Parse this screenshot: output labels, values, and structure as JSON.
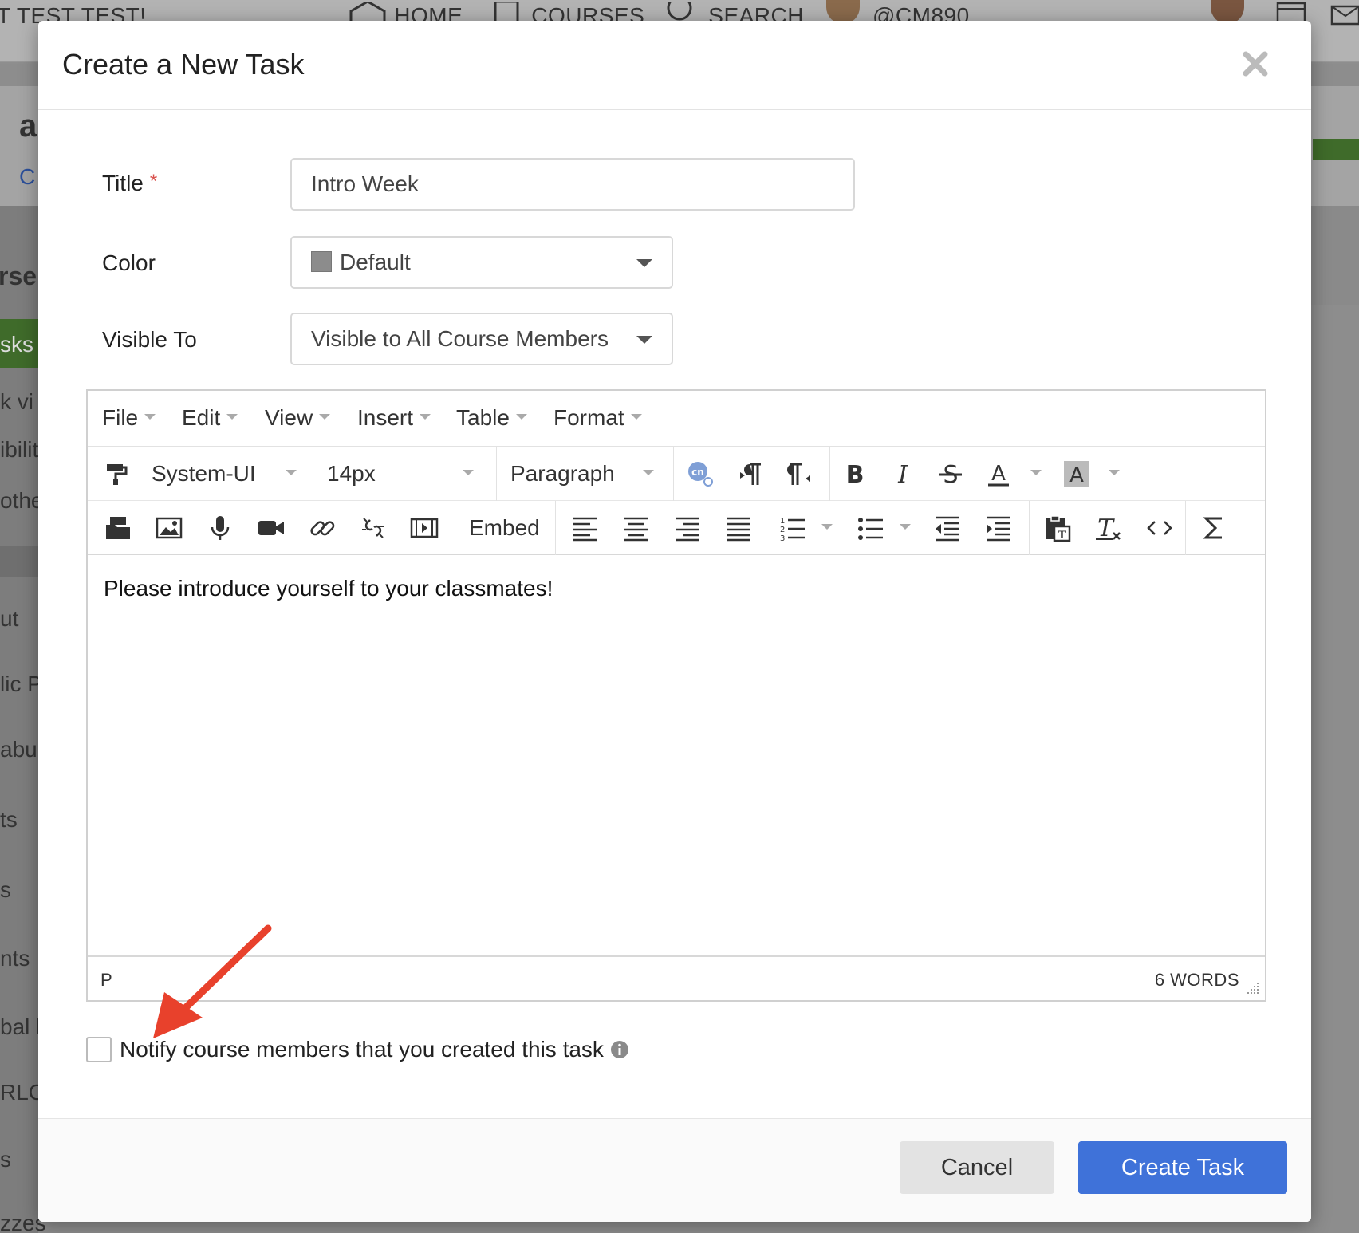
{
  "background": {
    "nav": {
      "course_title": "T TEST TEST!",
      "home": "HOME",
      "courses": "COURSES",
      "search": "SEARCH",
      "username": "@CM890"
    },
    "sidebar_fragments": [
      "a",
      "C",
      "rse",
      "sks",
      "k vi",
      "ibilit",
      "othe",
      "ut",
      "lic P",
      "abu",
      "ts",
      "s",
      "nts",
      "bal l",
      "RLO",
      "s",
      "zzes"
    ]
  },
  "modal": {
    "title": "Create a New Task",
    "form": {
      "title_label": "Title",
      "required_mark": "*",
      "title_value": "Intro Week",
      "color_label": "Color",
      "color_value": "Default",
      "color_swatch": "#8c8c8c",
      "visible_label": "Visible To",
      "visible_value": "Visible to All Course Members"
    },
    "editor": {
      "menu": [
        "File",
        "Edit",
        "View",
        "Insert",
        "Table",
        "Format"
      ],
      "font_family": "System-UI",
      "font_size": "14px",
      "block_format": "Paragraph",
      "embed_label": "Embed",
      "content": "Please introduce yourself to your classmates!",
      "status_path": "P",
      "word_count": "6 WORDS",
      "icons_row1": [
        "format-painter-icon",
        "citation-link-icon",
        "ltr-paragraph-icon",
        "rtl-paragraph-icon",
        "bold-icon",
        "italic-icon",
        "strikethrough-icon",
        "text-color-icon",
        "highlight-color-icon"
      ],
      "icons_row2": [
        "file-manager-icon",
        "image-icon",
        "microphone-icon",
        "video-camera-icon",
        "link-icon",
        "unlink-icon",
        "media-icon",
        "align-left-icon",
        "align-center-icon",
        "align-right-icon",
        "align-justify-icon",
        "numbered-list-icon",
        "bullet-list-icon",
        "outdent-icon",
        "indent-icon",
        "paste-text-icon",
        "clear-format-icon",
        "source-code-icon",
        "math-sigma-icon"
      ]
    },
    "notify_label": "Notify course members that you created this task",
    "notify_checked": false,
    "buttons": {
      "cancel": "Cancel",
      "create": "Create Task"
    },
    "colors": {
      "primary": "#3f72d9",
      "cancel_bg": "#e3e3e3",
      "required": "#d9534f",
      "annotation_arrow": "#e8412c"
    }
  }
}
